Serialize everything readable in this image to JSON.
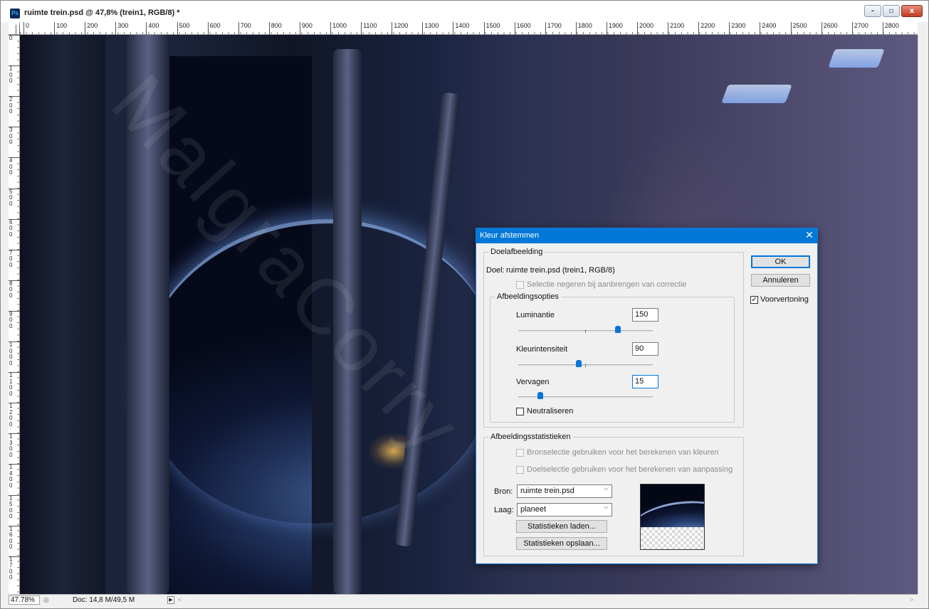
{
  "window": {
    "title": "ruimte trein.psd @ 47,8% (trein1, RGB/8) *",
    "app_icon": "Ps",
    "controls": {
      "minimize": "–",
      "restore": "▫",
      "close": "x"
    }
  },
  "ruler": {
    "horizontal": [
      "0",
      "100",
      "200",
      "300",
      "400",
      "500",
      "600",
      "700",
      "800",
      "900",
      "1000",
      "1100",
      "1200",
      "1300",
      "1400",
      "1500",
      "1600",
      "1700",
      "1800",
      "1900",
      "2000",
      "2100",
      "2200",
      "2300",
      "2400",
      "2500",
      "2600",
      "2700",
      "2800"
    ],
    "vertical": [
      "0",
      "100",
      "200",
      "300",
      "400",
      "500",
      "600",
      "700",
      "800",
      "900",
      "1000",
      "1100",
      "1200",
      "1300",
      "1400",
      "1500",
      "1600",
      "1700"
    ]
  },
  "statusbar": {
    "zoom": "47.78%",
    "doc_info": "Doc: 14,8 M/49,5 M",
    "arrow": "▶",
    "scroll_left": "<",
    "scroll_right": ">"
  },
  "dialog": {
    "title": "Kleur afstemmen",
    "close": "✕",
    "target_group": {
      "legend": "Doelafbeelding",
      "target_label": "Doel:",
      "target_value": "ruimte trein.psd (trein1, RGB/8)",
      "ignore_selection": {
        "label": "Selectie negeren bij aanbrengen van correctie",
        "checked": false,
        "enabled": false
      }
    },
    "image_options": {
      "legend": "Afbeeldingsopties",
      "luminance": {
        "label": "Luminantie",
        "value": "150",
        "min": 1,
        "max": 200,
        "num": 150
      },
      "color_intensity": {
        "label": "Kleurintensiteit",
        "value": "90",
        "min": 1,
        "max": 200,
        "num": 90
      },
      "fade": {
        "label": "Vervagen",
        "value": "15",
        "min": 0,
        "max": 100,
        "num": 15
      },
      "neutralize": {
        "label": "Neutraliseren",
        "checked": false
      }
    },
    "statistics": {
      "legend": "Afbeeldingsstatistieken",
      "use_source_selection": {
        "label": "Bronselectie gebruiken voor het berekenen van kleuren",
        "checked": false,
        "enabled": false
      },
      "use_target_selection": {
        "label": "Doelselectie gebruiken voor het berekenen van aanpassing",
        "checked": false,
        "enabled": false
      },
      "source_label": "Bron:",
      "source_value": "ruimte trein.psd",
      "layer_label": "Laag:",
      "layer_value": "planeet",
      "load_button": "Statistieken laden...",
      "save_button": "Statistieken opslaan..."
    },
    "buttons": {
      "ok": "OK",
      "cancel": "Annuleren"
    },
    "preview": {
      "label": "Voorvertoning",
      "checked": true
    },
    "dropdown_icon": "chevron-down-icon"
  }
}
